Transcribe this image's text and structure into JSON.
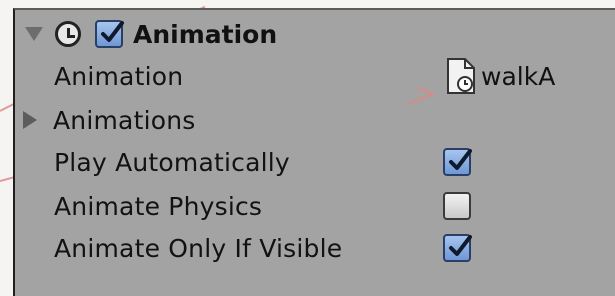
{
  "component": {
    "title": "Animation",
    "enabled": true
  },
  "fields": [
    {
      "label": "Animation",
      "value": "walkA"
    },
    {
      "label": "Animations"
    },
    {
      "label": "Play Automatically",
      "checked": true
    },
    {
      "label": "Animate Physics",
      "checked": false
    },
    {
      "label": "Animate Only If Visible",
      "checked": true
    }
  ],
  "colors": {
    "panel_bg": "#a3a3a3",
    "check_blue": "#7aa2dd",
    "guide_line": "#d98a86"
  },
  "icons": {
    "foldout": "triangle-down-icon",
    "component": "clock-icon",
    "asset": "animation-clip-icon",
    "collapsed": "triangle-right-icon"
  }
}
